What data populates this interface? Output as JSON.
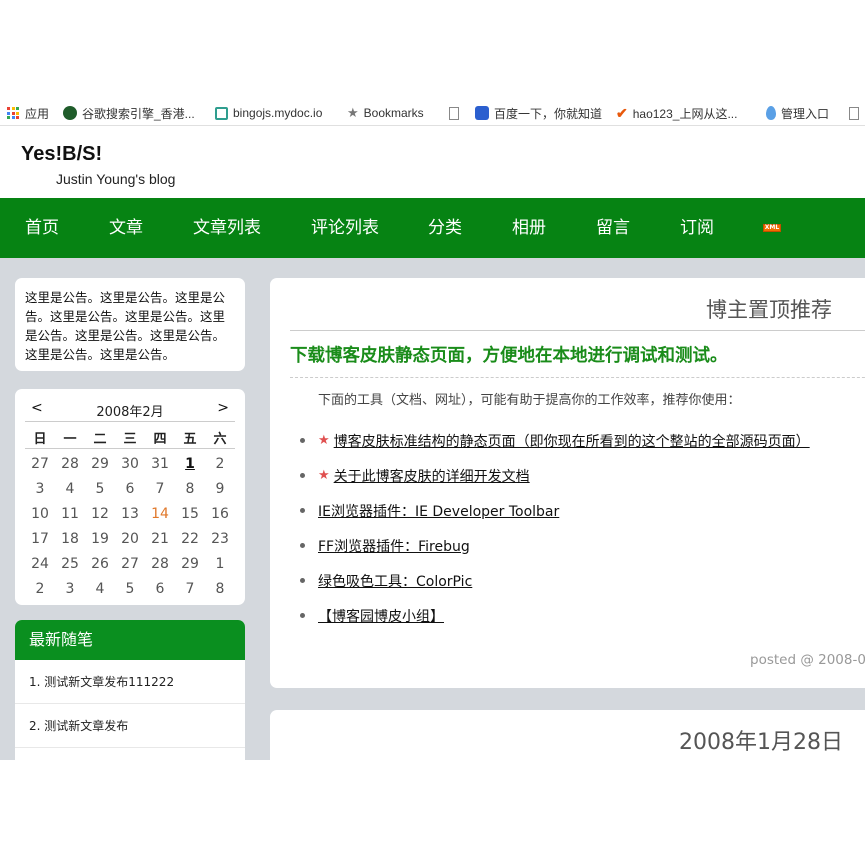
{
  "bookmarks": [
    {
      "label": "应用",
      "icon": "apps-icon"
    },
    {
      "label": "谷歌搜索引擎_香港...",
      "icon": "google-icon"
    },
    {
      "label": "bingojs.mydoc.io",
      "icon": "mydoc-icon"
    },
    {
      "label": "Bookmarks",
      "icon": "star-icon"
    },
    {
      "label": "",
      "icon": "page-icon"
    },
    {
      "label": "百度一下，你就知道",
      "icon": "baidu-icon"
    },
    {
      "label": "hao123_上网从这...",
      "icon": "hao123-icon"
    },
    {
      "label": "管理入口",
      "icon": "drop-icon"
    }
  ],
  "header": {
    "title": "Yes!B/S!",
    "subtitle": "Justin Young's blog"
  },
  "nav": {
    "items": [
      "首页",
      "文章",
      "文章列表",
      "评论列表",
      "分类",
      "相册",
      "留言",
      "订阅"
    ],
    "rss_badge": "XML"
  },
  "notice": {
    "text": "这里是公告。这里是公告。这里是公告。这里是公告。这里是公告。这里是公告。这里是公告。这里是公告。这里是公告。这里是公告。"
  },
  "calendar": {
    "prev": "<",
    "next": ">",
    "title": "2008年2月",
    "weekdays": [
      "日",
      "一",
      "二",
      "三",
      "四",
      "五",
      "六"
    ],
    "weeks": [
      [
        "27",
        "28",
        "29",
        "30",
        "31",
        "1",
        "2"
      ],
      [
        "3",
        "4",
        "5",
        "6",
        "7",
        "8",
        "9"
      ],
      [
        "10",
        "11",
        "12",
        "13",
        "14",
        "15",
        "16"
      ],
      [
        "17",
        "18",
        "19",
        "20",
        "21",
        "22",
        "23"
      ],
      [
        "24",
        "25",
        "26",
        "27",
        "28",
        "29",
        "1"
      ],
      [
        "2",
        "3",
        "4",
        "5",
        "6",
        "7",
        "8"
      ]
    ]
  },
  "recent": {
    "title": "最新随笔",
    "items": [
      "1. 测试新文章发布111222",
      "2. 测试新文章发布"
    ]
  },
  "post": {
    "category": "博主置顶推荐",
    "title": "下载博客皮肤静态页面，方便地在本地进行调试和测试。",
    "intro": "下面的工具（文档、网址），可能有助于提高你的工作效率，推荐你使用：",
    "links": [
      {
        "text": "博客皮肤标准结构的静态页面（即你现在所看到的这个整站的全部源码页面）",
        "starred": true
      },
      {
        "text": "关于此博客皮肤的详细开发文档",
        "starred": true
      },
      {
        "text": "IE浏览器插件：IE Developer Toolbar",
        "starred": false
      },
      {
        "text": "FF浏览器插件：Firebug",
        "starred": false
      },
      {
        "text": "绿色吸色工具：ColorPic",
        "starred": false
      },
      {
        "text": "【博客园博皮小组】",
        "starred": false
      }
    ],
    "footer": "posted @ 2008-0"
  },
  "post2": {
    "date": "2008年1月28日"
  },
  "colors": {
    "nav_bg": "#068313",
    "recent_header": "#0a8f1f",
    "title_green": "#1a8c1a",
    "today": "#e0782b",
    "content_bg": "#d4d8dd"
  }
}
